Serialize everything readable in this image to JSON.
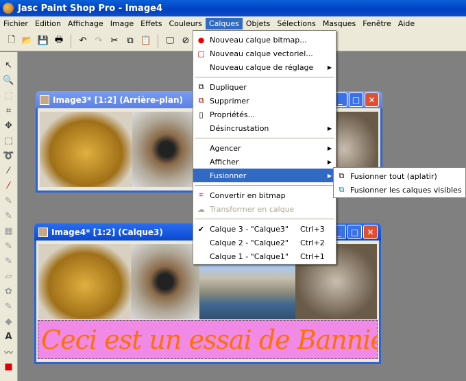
{
  "app": {
    "title": "Jasc Paint Shop Pro - Image4"
  },
  "menubar": [
    "Fichier",
    "Edition",
    "Affichage",
    "Image",
    "Effets",
    "Couleurs",
    "Calques",
    "Objets",
    "Sélections",
    "Masques",
    "Fenêtre",
    "Aide"
  ],
  "toolbar": [
    "new-icon",
    "open-icon",
    "save-icon",
    "print-icon",
    "undo-icon",
    "redo-icon",
    "cut-icon",
    "copy-icon",
    "paste-icon",
    "screen-icon",
    "no-icon"
  ],
  "windows": {
    "image3": {
      "title": "Image3* [1:2] (Arrière-plan)"
    },
    "image4": {
      "title": "Image4* [1:2] (Calque3)",
      "banner_text": "Ceci est un essai de Bannière"
    }
  },
  "calques_menu": {
    "items": [
      {
        "label": "Nouveau calque bitmap...",
        "icon": "new-bitmap-layer-icon"
      },
      {
        "label": "Nouveau calque vectoriel...",
        "icon": "new-vector-layer-icon"
      },
      {
        "label": "Nouveau calque de réglage",
        "submenu": true
      },
      {
        "label": "Dupliquer",
        "icon": "duplicate-icon"
      },
      {
        "label": "Supprimer",
        "icon": "delete-icon"
      },
      {
        "label": "Propriétés...",
        "icon": "properties-icon"
      },
      {
        "label": "Désincrustation",
        "submenu": true
      },
      {
        "label": "Agencer",
        "submenu": true
      },
      {
        "label": "Afficher",
        "submenu": true
      },
      {
        "label": "Fusionner",
        "submenu": true,
        "highlighted": true
      },
      {
        "label": "Convertir en bitmap",
        "icon": "convert-icon"
      },
      {
        "label": "Transformer en calque",
        "disabled": true
      },
      {
        "label": "Calque 3 - \"Calque3\"",
        "shortcut": "Ctrl+3",
        "checked": true
      },
      {
        "label": "Calque 2 - \"Calque2\"",
        "shortcut": "Ctrl+2"
      },
      {
        "label": "Calque 1 - \"Calque1\"",
        "shortcut": "Ctrl+1"
      }
    ]
  },
  "fusionner_submenu": [
    "Fusionner tout (aplatir)",
    "Fusionner les calques visibles"
  ],
  "colors": {
    "highlight": "#316ac5",
    "banner": "#f08ae6",
    "banner_text": "#ff7000"
  }
}
